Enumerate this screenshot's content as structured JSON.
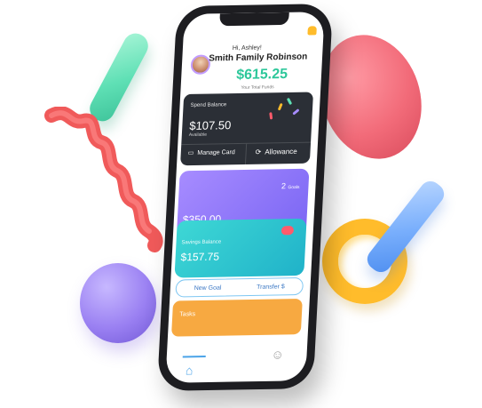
{
  "app": {
    "greeting": "Hi, Ashley!",
    "family_name": "Smith Family Robinson",
    "total_funds": "$615.25",
    "total_funds_label": "Your Total Funds"
  },
  "spend": {
    "title": "Spend Balance",
    "amount": "$107.50",
    "subtitle": "Available",
    "manage_label": "Manage Card",
    "allowance_label": "Allowance"
  },
  "goals": {
    "count": "2",
    "count_label": "Goals",
    "amount": "$350.00"
  },
  "savings": {
    "title": "Savings Balance",
    "amount": "$157.75"
  },
  "actions": {
    "new_goal": "New Goal",
    "transfer": "Transfer $"
  },
  "tasks": {
    "label": "Tasks"
  },
  "colors": {
    "accent_green": "#2cc79a",
    "spend_bg": "#2b2f36",
    "goals_bg": "#7b66f4",
    "savings_bg": "#20b2c9",
    "tasks_bg": "#f7a941",
    "tab_blue": "#4aa3e8"
  },
  "icons": {
    "bell": "bell-icon",
    "card": "card-icon",
    "allowance": "refresh-icon",
    "home": "home-icon",
    "people": "people-icon",
    "piggy": "piggy-bank-icon"
  }
}
